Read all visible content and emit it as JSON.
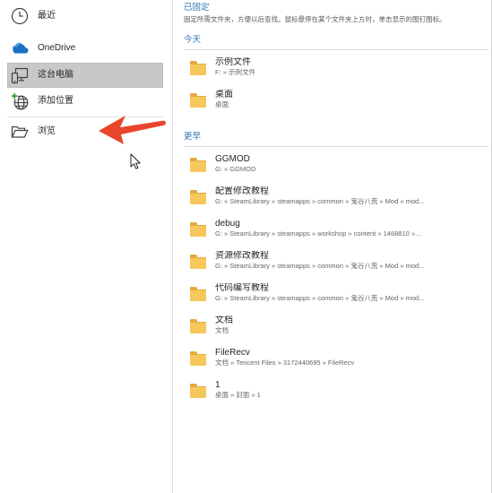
{
  "nav": {
    "items": [
      {
        "label": "最近",
        "icon": "clock-icon",
        "selected": false
      },
      {
        "label": "OneDrive",
        "icon": "onedrive-cloud-icon",
        "selected": false
      },
      {
        "label": "这台电脑",
        "icon": "this-pc-icon",
        "selected": true
      },
      {
        "label": "添加位置",
        "icon": "add-place-globe-icon",
        "selected": false
      },
      {
        "label": "浏览",
        "icon": "open-folder-icon",
        "selected": false
      }
    ]
  },
  "pinned": {
    "heading": "已固定",
    "hint": "固定所需文件夹，方便以后查找。鼠标悬停在某个文件夹上方时，单击显示的图钉图标。"
  },
  "groups": [
    {
      "heading": "今天",
      "items": [
        {
          "name": "示例文件",
          "path": "F: » 示例文件",
          "icon": "folder-icon"
        },
        {
          "name": "桌面",
          "path": "桌面",
          "icon": "folder-icon"
        }
      ]
    },
    {
      "heading": "更早",
      "items": [
        {
          "name": "GGMOD",
          "path": "G: » GGMOD",
          "icon": "folder-icon"
        },
        {
          "name": "配置修改教程",
          "path": "G: » SteamLibrary » steamapps » common » 鬼谷八荒 » Mod » mod...",
          "icon": "folder-icon"
        },
        {
          "name": "debug",
          "path": "G: » SteamLibrary » steamapps » workshop » content » 1468810 »...",
          "icon": "folder-icon"
        },
        {
          "name": "资源修改教程",
          "path": "G: » SteamLibrary » steamapps » common » 鬼谷八荒 » Mod » mod...",
          "icon": "folder-icon"
        },
        {
          "name": "代码编写教程",
          "path": "G: » SteamLibrary » steamapps » common » 鬼谷八荒 » Mod » mod...",
          "icon": "folder-icon"
        },
        {
          "name": "文档",
          "path": "文档",
          "icon": "folder-icon"
        },
        {
          "name": "FileRecv",
          "path": "文档 » Tencent Files » 3172440695 » FileRecv",
          "icon": "folder-icon"
        },
        {
          "name": "1",
          "path": "桌面 » 封面 » 1",
          "icon": "folder-icon"
        }
      ]
    }
  ],
  "overlays": {
    "arrow_icon": "annotation-arrow-icon",
    "cursor_icon": "mouse-pointer-icon"
  },
  "colors": {
    "accent": "#2e74b5",
    "selected_bg": "#c8c8c8",
    "folder": "#f6c85b",
    "folder_tab": "#e2ab3f",
    "arrow": "#e8462c",
    "onedrive": "#1b6fc4",
    "add_place_plus": "#3a9a3a"
  }
}
